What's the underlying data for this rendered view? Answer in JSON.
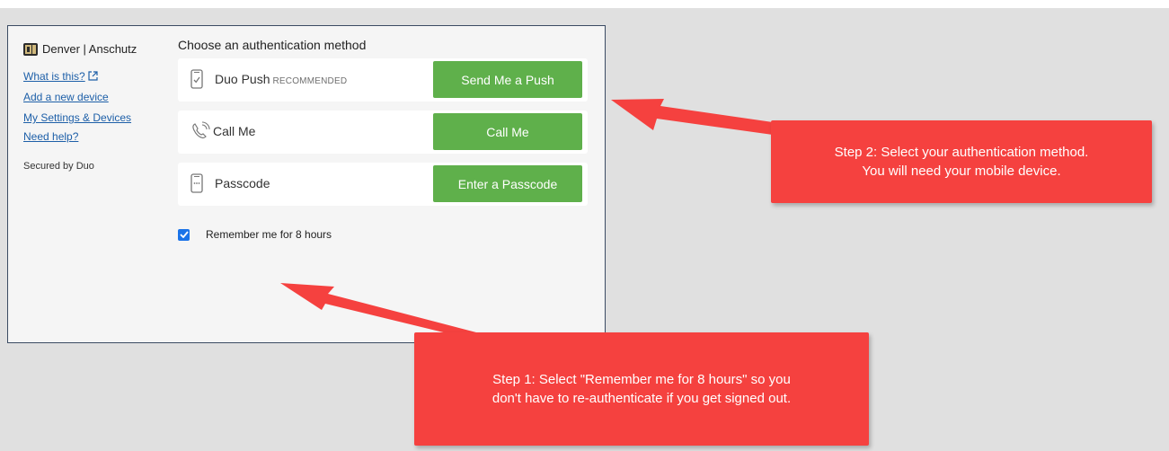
{
  "sidebar": {
    "org_name": "Denver | Anschutz",
    "links": [
      "What is this?",
      "Add a new device",
      "My Settings & Devices",
      "Need help?"
    ],
    "secured_by": "Secured by Duo"
  },
  "auth": {
    "title": "Choose an authentication method",
    "methods": [
      {
        "icon": "phone-push-icon",
        "label": "Duo Push",
        "badge": "RECOMMENDED",
        "button": "Send Me a Push"
      },
      {
        "icon": "phone-call-icon",
        "label": "Call Me",
        "button": "Call Me"
      },
      {
        "icon": "passcode-device-icon",
        "label": "Passcode",
        "button": "Enter a Passcode"
      }
    ],
    "remember": {
      "label": "Remember me for 8 hours",
      "checked": true
    }
  },
  "callouts": {
    "step2": {
      "line1": "Step 2: Select your authentication method.",
      "line2": "You will need your mobile device."
    },
    "step1": {
      "line1": "Step 1: Select \"Remember me for 8 hours\" so you",
      "line2": "don't have to re-authenticate if you get signed out."
    }
  },
  "colors": {
    "button_green": "#5fb04b",
    "link_blue": "#1d5fa8",
    "callout_red": "#f5413f",
    "checkbox_blue": "#1a73e8"
  }
}
